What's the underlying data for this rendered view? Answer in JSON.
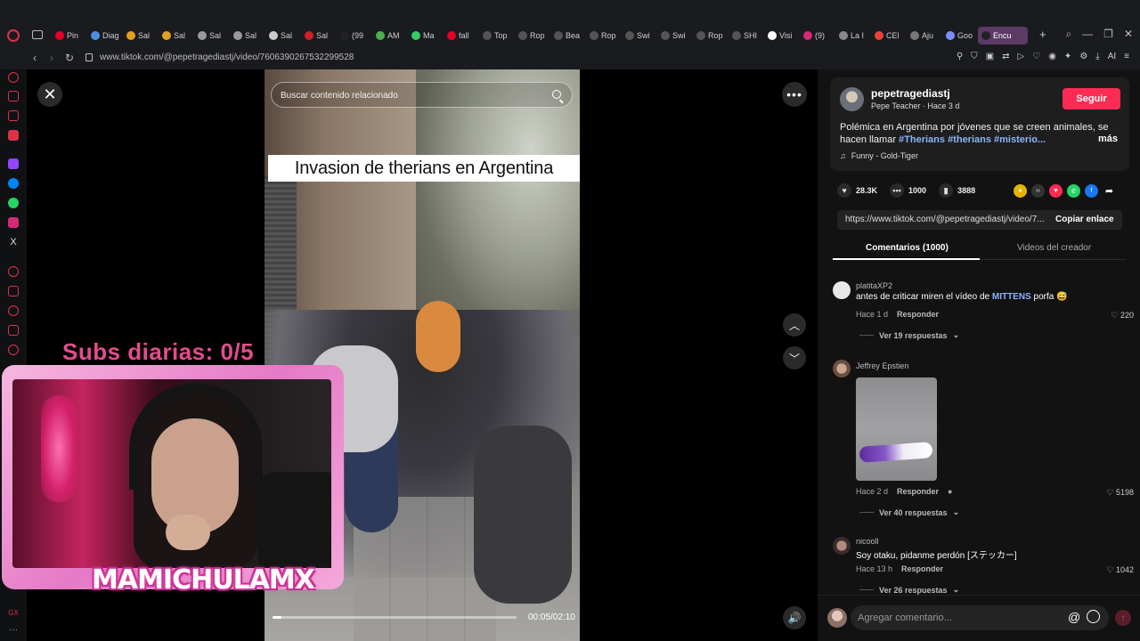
{
  "browser": {
    "url": "www.tiktok.com/@pepetragediastj/video/7606390267532299528",
    "tabs": [
      {
        "label": "Pin",
        "icon": "pinterest-icon",
        "color": "#e60023"
      },
      {
        "label": "Diag",
        "icon": "diagram-icon",
        "color": "#4a90e2"
      },
      {
        "label": "Sal",
        "icon": "star-icon",
        "color": "#e0a020"
      },
      {
        "label": "Sal",
        "icon": "star-icon",
        "color": "#e0a020"
      },
      {
        "label": "Sal",
        "icon": "doc-icon",
        "color": "#999999"
      },
      {
        "label": "Sal",
        "icon": "doc-icon",
        "color": "#999999"
      },
      {
        "label": "Sal",
        "icon": "pill-icon",
        "color": "#cccccc"
      },
      {
        "label": "Sal",
        "icon": "sale-icon",
        "color": "#d0202a"
      },
      {
        "label": "(99",
        "icon": "tiktok-icon",
        "color": "#222222"
      },
      {
        "label": "AM",
        "icon": "am-icon",
        "color": "#4caf50"
      },
      {
        "label": "Ma",
        "icon": "k-icon",
        "color": "#33cc66"
      },
      {
        "label": "fall",
        "icon": "pinterest-icon",
        "color": "#e60023"
      },
      {
        "label": "Top",
        "icon": "s-icon",
        "color": "#555555"
      },
      {
        "label": "Rop",
        "icon": "s-icon",
        "color": "#555555"
      },
      {
        "label": "Bea",
        "icon": "s-icon",
        "color": "#555555"
      },
      {
        "label": "Rop",
        "icon": "s-icon",
        "color": "#555555"
      },
      {
        "label": "Swi",
        "icon": "s-icon",
        "color": "#555555"
      },
      {
        "label": "Swi",
        "icon": "s-icon",
        "color": "#555555"
      },
      {
        "label": "Rop",
        "icon": "s-icon",
        "color": "#555555"
      },
      {
        "label": "SHI",
        "icon": "s-icon",
        "color": "#555555"
      },
      {
        "label": "Visi",
        "icon": "notion-icon",
        "color": "#ffffff"
      },
      {
        "label": "(9)",
        "icon": "instagram-icon",
        "color": "#d62976"
      },
      {
        "label": "La I",
        "icon": "dot-icon",
        "color": "#888888"
      },
      {
        "label": "CEl",
        "icon": "gmail-icon",
        "color": "#ea4335"
      },
      {
        "label": "Aju",
        "icon": "settings-icon",
        "color": "#777777"
      },
      {
        "label": "Goo",
        "icon": "gemini-icon",
        "color": "#7b8cff"
      },
      {
        "label": "Encu",
        "icon": "tiktok-icon",
        "color": "#222222",
        "active": true
      }
    ]
  },
  "video": {
    "search_placeholder": "Buscar contenido relacionado",
    "caption": "Invasion de therians en Argentina",
    "time": "00:05/02:10",
    "progress": 0.038
  },
  "overlay": {
    "subs_text": "Subs diarias: 0/5",
    "streamer_name": "MAMICHULAMX"
  },
  "post": {
    "author": "pepetragediastj",
    "author_sub": "Pepe Teacher · Hace 3 d",
    "follow_label": "Seguir",
    "description_text": "Polémica en Argentina por jóvenes que se creen animales, se hacen llamar",
    "hashtags": "#Therians #therians #misterio...",
    "more_label": "más",
    "music": "Funny - Gold-Tiger",
    "likes": "28.3K",
    "comments_count": "1000",
    "saves": "3888",
    "link": "https://www.tiktok.com/@pepetragediastj/video/7...",
    "copy_label": "Copiar enlace",
    "tab_comments": "Comentarios (1000)",
    "tab_creator": "Videos del creador"
  },
  "comments": [
    {
      "user": "platitaXP2",
      "text_before": "antes de criticar miren el vídeo de ",
      "mention": "MITTENS",
      "text_after": " porfa 😅",
      "time": "Hace 1 d",
      "reply_label": "Responder",
      "likes": "220",
      "replies": "Ver 19 respuestas"
    },
    {
      "user": "Jeffrey Epstien",
      "time": "Hace 2 d",
      "reply_label": "Responder",
      "likes": "5198",
      "replies": "Ver 40 respuestas"
    },
    {
      "user": "nicooll",
      "text": "Soy otaku, pidanme perdón [ステッカー]",
      "time": "Hace 13 h",
      "reply_label": "Responder",
      "likes": "1042",
      "replies": "Ver 26 respuestas"
    }
  ],
  "comment_input": {
    "placeholder": "Agregar comentario..."
  },
  "colors": {
    "accent": "#fe2c55",
    "hashtag": "#8ab4f8",
    "overlay_pink": "#e24d8c"
  }
}
